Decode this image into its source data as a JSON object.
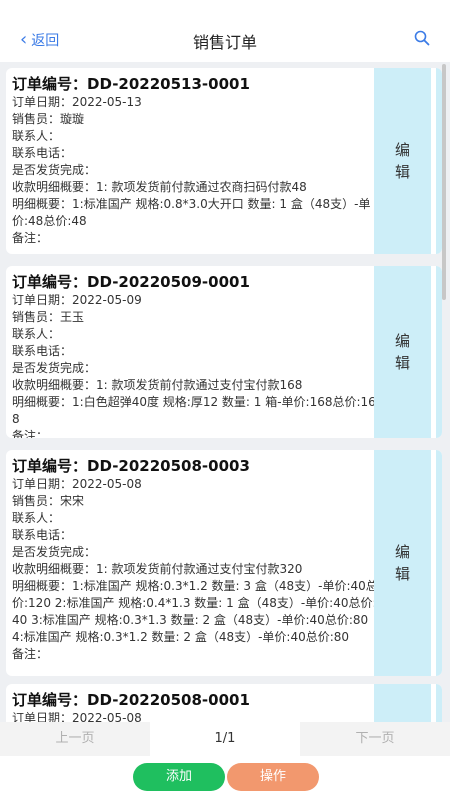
{
  "header": {
    "back_label": "返回",
    "title": "销售订单"
  },
  "labels": {
    "order_no": "订单编号：",
    "order_date": "订单日期：",
    "salesperson": "销售员：",
    "contact": "联系人：",
    "phone": "联系电话：",
    "shipped": "是否发货完成：",
    "payment": "收款明细概要：",
    "detail": "明细概要：",
    "remark": "备注：",
    "edit": "编辑"
  },
  "orders": [
    {
      "order_no": "DD-20220513-0001",
      "order_date": "2022-05-13",
      "salesperson": "璇璇",
      "payment": "1: 款项发货前付款通过农商扫码付款48",
      "detail": "1:标准国产 规格:0.8*3.0大开口 数量: 1 盒（48支）-单价:48总价:48"
    },
    {
      "order_no": "DD-20220509-0001",
      "order_date": "2022-05-09",
      "salesperson": "王玉",
      "payment": "1: 款项发货前付款通过支付宝付款168",
      "detail": "1:白色超弹40度 规格:厚12 数量: 1 箱-单价:168总价:168"
    },
    {
      "order_no": "DD-20220508-0003",
      "order_date": "2022-05-08",
      "salesperson": "宋宋",
      "payment": "1: 款项发货前付款通过支付宝付款320",
      "detail": "1:标准国产 规格:0.3*1.2 数量: 3 盒（48支）-单价:40总价:120 2:标准国产 规格:0.4*1.3 数量: 1 盒（48支）-单价:40总价:40 3:标准国产 规格:0.3*1.3 数量: 2 盒（48支）-单价:40总价:80 4:标准国产 规格:0.3*1.2 数量: 2 盒（48支）-单价:40总价:80"
    },
    {
      "order_no": "DD-20220508-0001",
      "order_date": "2022-05-08"
    }
  ],
  "pager": {
    "prev": "上一页",
    "page": "1/1",
    "next": "下一页"
  },
  "actions": {
    "add": "添加",
    "operate": "操作"
  },
  "colors": {
    "accent": "#3b7be6",
    "edit_bg": "#cdeef8",
    "add_btn": "#1fbf5f",
    "op_btn": "#f2986e"
  }
}
